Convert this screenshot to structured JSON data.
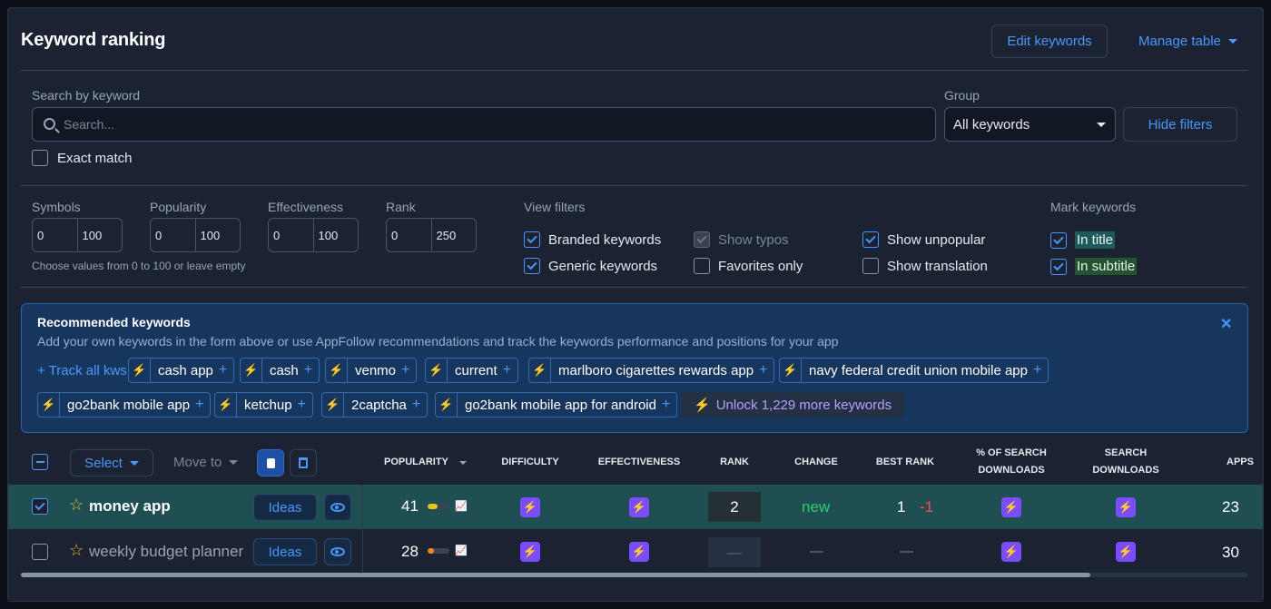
{
  "header": {
    "title": "Keyword ranking",
    "edit_keywords": "Edit keywords",
    "manage_table": "Manage table"
  },
  "search": {
    "label": "Search by keyword",
    "placeholder": "Search...",
    "exact_match": "Exact match",
    "group_label": "Group",
    "group_value": "All keywords",
    "hide_filters": "Hide filters"
  },
  "filters": {
    "symbols": {
      "label": "Symbols",
      "min": "0",
      "max": "100"
    },
    "popularity": {
      "label": "Popularity",
      "min": "0",
      "max": "100"
    },
    "effectiveness": {
      "label": "Effectiveness",
      "min": "0",
      "max": "100"
    },
    "rank": {
      "label": "Rank",
      "min": "0",
      "max": "250"
    },
    "hint": "Choose values from 0 to 100 or leave empty",
    "view_filters_label": "View filters",
    "branded": "Branded keywords",
    "generic": "Generic keywords",
    "show_typos": "Show typos",
    "favorites_only": "Favorites only",
    "show_unpopular": "Show unpopular",
    "show_translation": "Show translation",
    "mark_keywords_label": "Mark keywords",
    "in_title": "In title",
    "in_subtitle": "In subtitle"
  },
  "recommended": {
    "title": "Recommended keywords",
    "description": "Add your own keywords in the form above or use AppFollow recommendations and track the keywords performance and positions for your app",
    "track_all": "+ Track all kws",
    "chips": [
      "cash app",
      "cash",
      "venmo",
      "current",
      "marlboro cigarettes rewards app",
      "navy federal credit union mobile app",
      "go2bank mobile app",
      "ketchup",
      "2captcha",
      "go2bank mobile app for android"
    ],
    "unlock": "Unlock 1,229 more keywords"
  },
  "toolbar": {
    "select": "Select",
    "move_to": "Move to"
  },
  "columns": {
    "popularity": "POPULARITY",
    "difficulty": "DIFFICULTY",
    "effectiveness": "EFFECTIVENESS",
    "rank": "RANK",
    "change": "CHANGE",
    "best_rank": "BEST RANK",
    "pct_search_1": "% OF SEARCH",
    "pct_search_2": "DOWNLOADS",
    "search_dl_1": "SEARCH",
    "search_dl_2": "DOWNLOADS",
    "apps": "APPS"
  },
  "rows": [
    {
      "keyword": "money app",
      "ideas": "Ideas",
      "popularity": "41",
      "popularity_pct": 0.45,
      "popularity_color": "#e8c417",
      "rank": "2",
      "change": "new",
      "best_rank": "1",
      "best_delta": "-1",
      "apps": "23",
      "checked": true
    },
    {
      "keyword": "weekly budget planner",
      "ideas": "Ideas",
      "popularity": "28",
      "popularity_pct": 0.3,
      "popularity_color": "#f08c1a",
      "rank": "—",
      "change": "—",
      "best_rank": "—",
      "best_delta": "",
      "apps": "30",
      "checked": false
    }
  ],
  "colors": {
    "accent": "#4c97ff",
    "bolt": "#7c4dff",
    "change_new": "#2ecc71",
    "delta_negative": "#ff4d4d"
  }
}
